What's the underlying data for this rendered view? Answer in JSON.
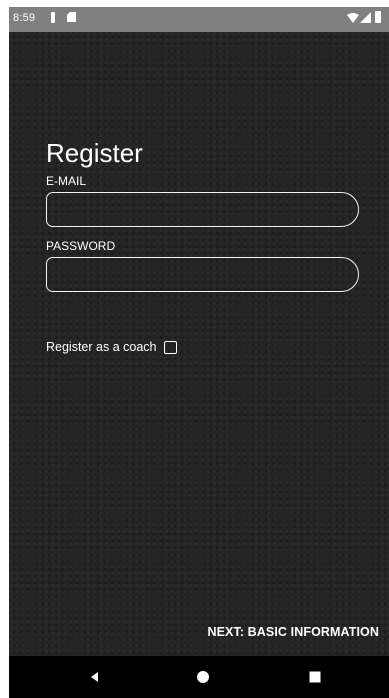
{
  "status_bar": {
    "time": "8:59",
    "icons": [
      "sim-icon",
      "sd-card-icon",
      "wifi-icon",
      "signal-icon",
      "battery-icon"
    ]
  },
  "screen": {
    "title": "Register",
    "email": {
      "label": "E-MAIL",
      "value": "",
      "placeholder": ""
    },
    "password": {
      "label": "PASSWORD",
      "value": "",
      "placeholder": ""
    },
    "coach_checkbox": {
      "label": "Register as a coach",
      "checked": false
    },
    "next_button_label": "NEXT: BASIC INFORMATION"
  },
  "nav_bar": {
    "icons": [
      "back-icon",
      "home-icon",
      "recents-icon"
    ]
  },
  "colors": {
    "background": "#242424",
    "text": "#ffffff",
    "status_bar": "#808080",
    "nav_bar": "#000000"
  }
}
